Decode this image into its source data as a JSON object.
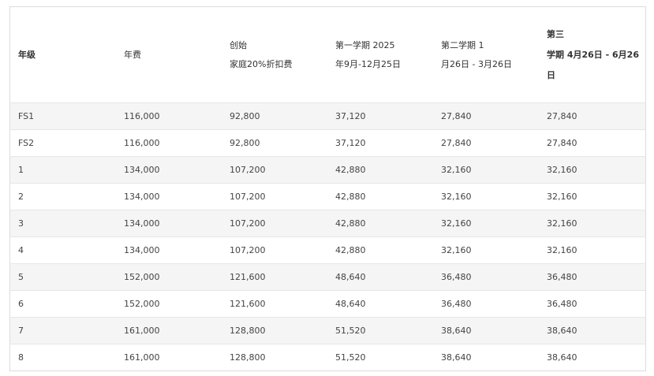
{
  "headers": [
    {
      "lines": [
        "年级"
      ],
      "bold": true
    },
    {
      "lines": [
        "年费"
      ],
      "bold": false
    },
    {
      "lines": [
        "创始",
        "家庭20%折扣费"
      ],
      "bold": false
    },
    {
      "lines": [
        "第一学期 2025",
        "年9月-12月25日"
      ],
      "bold": false
    },
    {
      "lines": [
        "第二学期 1",
        "月26日 - 3月26日"
      ],
      "bold": false
    },
    {
      "lines": [
        "第三",
        "学期 4月26日 - 6月26",
        "日"
      ],
      "bold": true
    }
  ],
  "rows": [
    [
      "FS1",
      "116,000",
      "92,800",
      "37,120",
      "27,840",
      "27,840"
    ],
    [
      "FS2",
      "116,000",
      "92,800",
      "37,120",
      "27,840",
      "27,840"
    ],
    [
      "1",
      "134,000",
      "107,200",
      "42,880",
      "32,160",
      "32,160"
    ],
    [
      "2",
      "134,000",
      "107,200",
      "42,880",
      "32,160",
      "32,160"
    ],
    [
      "3",
      "134,000",
      "107,200",
      "42,880",
      "32,160",
      "32,160"
    ],
    [
      "4",
      "134,000",
      "107,200",
      "42,880",
      "32,160",
      "32,160"
    ],
    [
      "5",
      "152,000",
      "121,600",
      "48,640",
      "36,480",
      "36,480"
    ],
    [
      "6",
      "152,000",
      "121,600",
      "48,640",
      "36,480",
      "36,480"
    ],
    [
      "7",
      "161,000",
      "128,800",
      "51,520",
      "38,640",
      "38,640"
    ],
    [
      "8",
      "161,000",
      "128,800",
      "51,520",
      "38,640",
      "38,640"
    ]
  ]
}
